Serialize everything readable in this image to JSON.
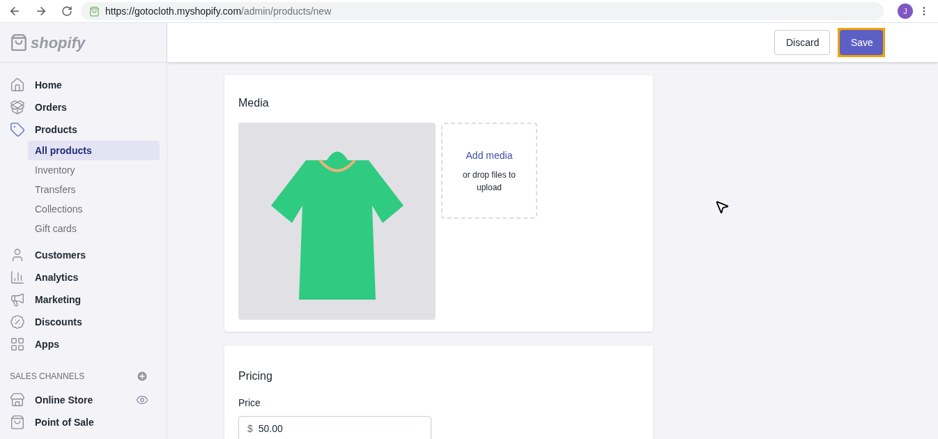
{
  "browser": {
    "url_host": "https://gotocloth.myshopify.com",
    "url_path": "/admin/products/new",
    "avatar": "J"
  },
  "logo": "shopify",
  "buttons": [
    {
      "label": "Discard",
      "kind": "secondary",
      "highlighted": false
    },
    {
      "label": "Save",
      "kind": "primary",
      "highlighted": true
    }
  ],
  "sidebar": {
    "items": [
      {
        "label": "Home",
        "selected": false
      },
      {
        "label": "Orders",
        "selected": false
      },
      {
        "label": "Products",
        "selected": true,
        "children": [
          {
            "label": "All products",
            "selected": true
          },
          {
            "label": "Inventory",
            "selected": false
          },
          {
            "label": "Transfers",
            "selected": false
          },
          {
            "label": "Collections",
            "selected": false
          },
          {
            "label": "Gift cards",
            "selected": false
          }
        ]
      },
      {
        "label": "Customers",
        "selected": false
      },
      {
        "label": "Analytics",
        "selected": false
      },
      {
        "label": "Marketing",
        "selected": false
      },
      {
        "label": "Discounts",
        "selected": false
      },
      {
        "label": "Apps",
        "selected": false
      }
    ],
    "section_title": "SALES CHANNELS",
    "channels": [
      {
        "label": "Online Store",
        "preview": true
      },
      {
        "label": "Point of Sale",
        "preview": false
      }
    ]
  },
  "media": {
    "title": "Media",
    "add_label": "Add media",
    "add_hint": "or drop files to upload"
  },
  "pricing": {
    "title": "Pricing",
    "price_label": "Price",
    "currency": "$",
    "price": "50.00"
  }
}
